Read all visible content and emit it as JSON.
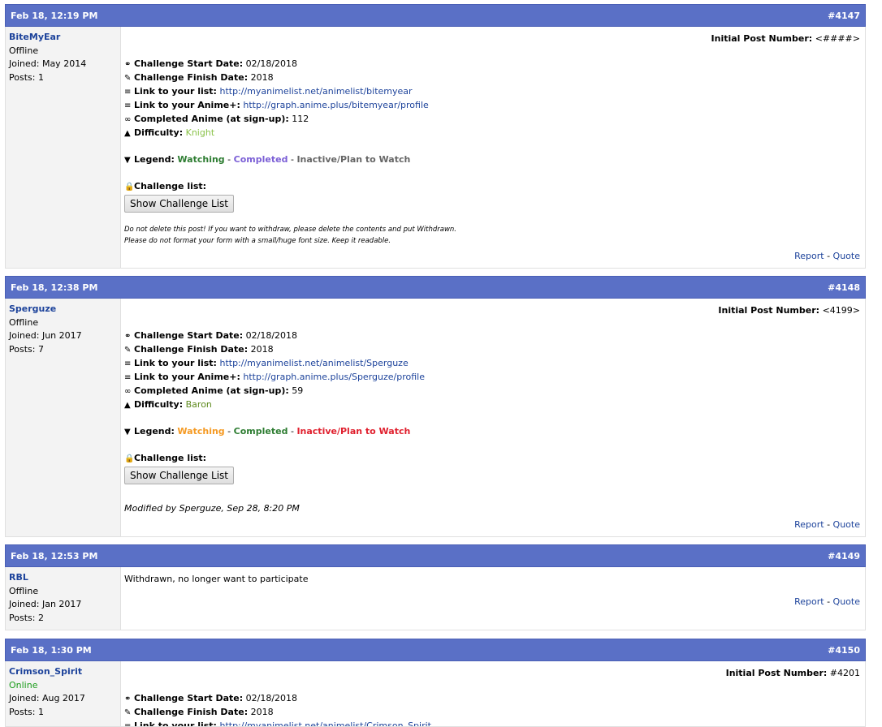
{
  "colors": {
    "header": "#5a70c6",
    "link": "#1d439b",
    "online": "#1a9c1a"
  },
  "posts": [
    {
      "date": "Feb 18, 12:19 PM",
      "num": "#4147",
      "user": "BiteMyEar",
      "status": "Offline",
      "joined": "Joined: May 2014",
      "posts": "Posts: 1",
      "ipn_label": "Initial Post Number:",
      "ipn_value": "<####>",
      "start_label": "Challenge Start Date:",
      "start_value": "02/18/2018",
      "finish_label": "Challenge Finish Date:",
      "finish_value": "2018",
      "list_label": "Link to your list:",
      "list_value": "http://myanimelist.net/animelist/bitemyear",
      "ap_label": "Link to your Anime+:",
      "ap_value": "http://graph.anime.plus/bitemyear/profile",
      "comp_label": "Completed Anime (at sign-up):",
      "comp_value": "112",
      "diff_label": "Difficulty:",
      "diff_value": "Knight",
      "legend_label": "Legend:",
      "leg_watching": "Watching",
      "leg_completed": "Completed",
      "leg_inactive": "Inactive/Plan to Watch",
      "dash": "-",
      "cl_label": "Challenge list:",
      "btn": "Show Challenge List",
      "note1": "Do not delete this post! If you want to withdraw, please delete the contents and put Withdrawn.",
      "note2": "Please do not format your form with a small/huge font size. Keep it readable.",
      "report": "Report",
      "quote": "Quote"
    },
    {
      "date": "Feb 18, 12:38 PM",
      "num": "#4148",
      "user": "Sperguze",
      "status": "Offline",
      "joined": "Joined: Jun 2017",
      "posts": "Posts: 7",
      "ipn_label": "Initial Post Number:",
      "ipn_value": "<4199>",
      "start_label": "Challenge Start Date:",
      "start_value": "02/18/2018",
      "finish_label": "Challenge Finish Date:",
      "finish_value": "2018",
      "list_label": "Link to your list:",
      "list_value": "http://myanimelist.net/animelist/Sperguze",
      "ap_label": "Link to your Anime+:",
      "ap_value": "http://graph.anime.plus/Sperguze/profile",
      "comp_label": "Completed Anime (at sign-up):",
      "comp_value": "59",
      "diff_label": "Difficulty:",
      "diff_value": "Baron",
      "legend_label": "Legend:",
      "leg_watching": "Watching",
      "leg_completed": "Completed",
      "leg_inactive": "Inactive/Plan to Watch",
      "dash": "-",
      "cl_label": "Challenge list:",
      "btn": "Show Challenge List",
      "modified": "Modified by Sperguze, Sep 28, 8:20 PM",
      "report": "Report",
      "quote": "Quote"
    },
    {
      "date": "Feb 18, 12:53 PM",
      "num": "#4149",
      "user": "RBL",
      "status": "Offline",
      "joined": "Joined: Jan 2017",
      "posts": "Posts: 2",
      "body": "Withdrawn, no longer want to participate",
      "report": "Report",
      "quote": "Quote"
    },
    {
      "date": "Feb 18, 1:30 PM",
      "num": "#4150",
      "user": "Crimson_Spirit",
      "status": "Online",
      "joined": "Joined: Aug 2017",
      "posts": "Posts: 1",
      "ipn_label": "Initial Post Number:",
      "ipn_value": "#4201",
      "start_label": "Challenge Start Date:",
      "start_value": "02/18/2018",
      "finish_label": "Challenge Finish Date:",
      "finish_value": "2018",
      "list_label": "Link to your list:",
      "list_value": "http://myanimelist.net/animelist/Crimson_Spirit"
    }
  ]
}
